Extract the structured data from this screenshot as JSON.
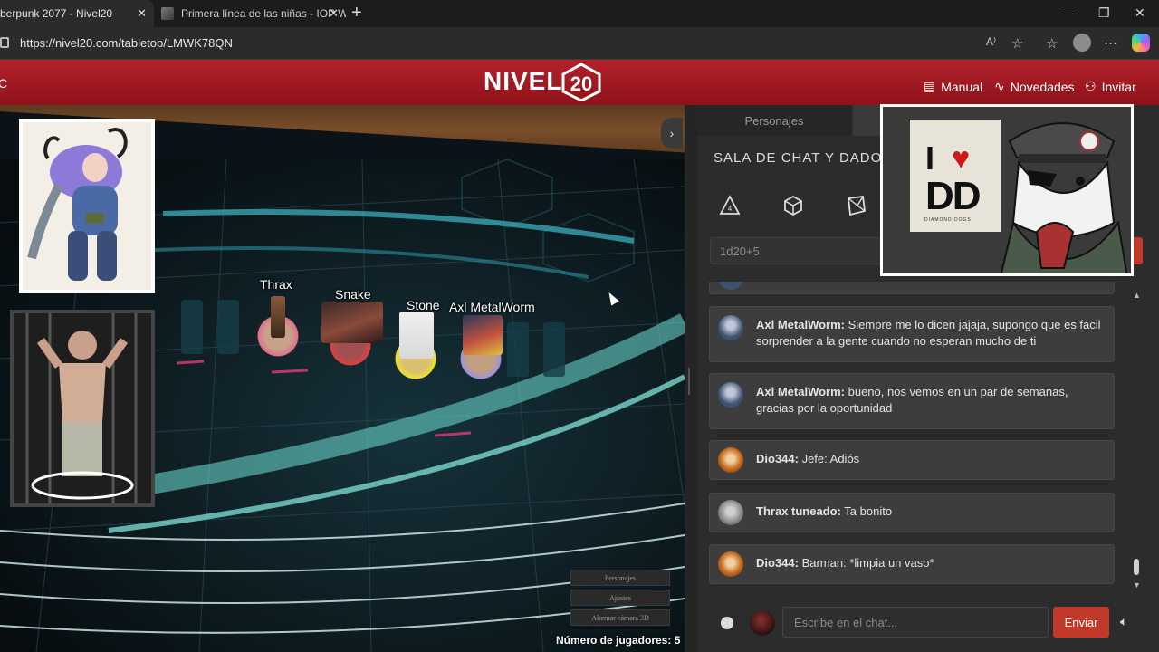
{
  "browser": {
    "tabs": [
      {
        "title": "berpunk 2077 - Nivel20",
        "active": true
      },
      {
        "title": "Primera línea de las niñas - IOP W",
        "active": false
      }
    ],
    "url": "https://nivel20.com/tabletop/LMWK78QN"
  },
  "header": {
    "logo": "NIVEL",
    "logo_number": "20",
    "nav": [
      {
        "label": "Manual",
        "icon": "book-icon"
      },
      {
        "label": "Novedades",
        "icon": "activity-icon"
      },
      {
        "label": "Invitar",
        "icon": "add-user-icon"
      }
    ]
  },
  "map": {
    "tokens": [
      {
        "name": "Thrax"
      },
      {
        "name": "Snake"
      },
      {
        "name": "Stone"
      },
      {
        "name": "Axl MetalWorm"
      }
    ],
    "buttons": [
      "Personajes",
      "Ajustes",
      "Alternar cámara 3D"
    ],
    "players_label": "Número de jugadores: 5"
  },
  "panel": {
    "tabs": [
      "Personajes"
    ],
    "chat_title": "SALA DE CHAT Y DADOS",
    "dice_icons": [
      "d4-icon",
      "d6-icon",
      "d8-icon"
    ],
    "dice_input_placeholder": "1d20+5",
    "messages": [
      {
        "author": "Axl MetalWorm:",
        "text": " Siempre me lo dicen jajaja, supongo que es facil sorprender a la gente cuando no esperan mucho de ti",
        "avatar_color": "#3b5270"
      },
      {
        "author": "Axl MetalWorm:",
        "text": " bueno, nos vemos en un par de semanas, gracias por la oportunidad",
        "avatar_color": "#3b5270"
      },
      {
        "author": "Dio344:",
        "text": " Jefe: Adiós",
        "avatar_color": "#c86a1e"
      },
      {
        "author": "Thrax tuneado:",
        "text": " Ta bonito",
        "avatar_color": "#8f8f8f"
      },
      {
        "author": "Dio344:",
        "text": " Barman: *limpia un vaso*",
        "avatar_color": "#c86a1e"
      }
    ],
    "composer": {
      "placeholder": "Escribe en el chat...",
      "send_label": "Enviar"
    }
  },
  "overlay": {
    "sign_i": "I",
    "sign_dd": "DD",
    "sign_sub": "DIAMOND DOGS"
  },
  "colors": {
    "header_red": "#a8121c",
    "accent_red": "#c0392b",
    "panel_bg": "#2c2c2c"
  }
}
